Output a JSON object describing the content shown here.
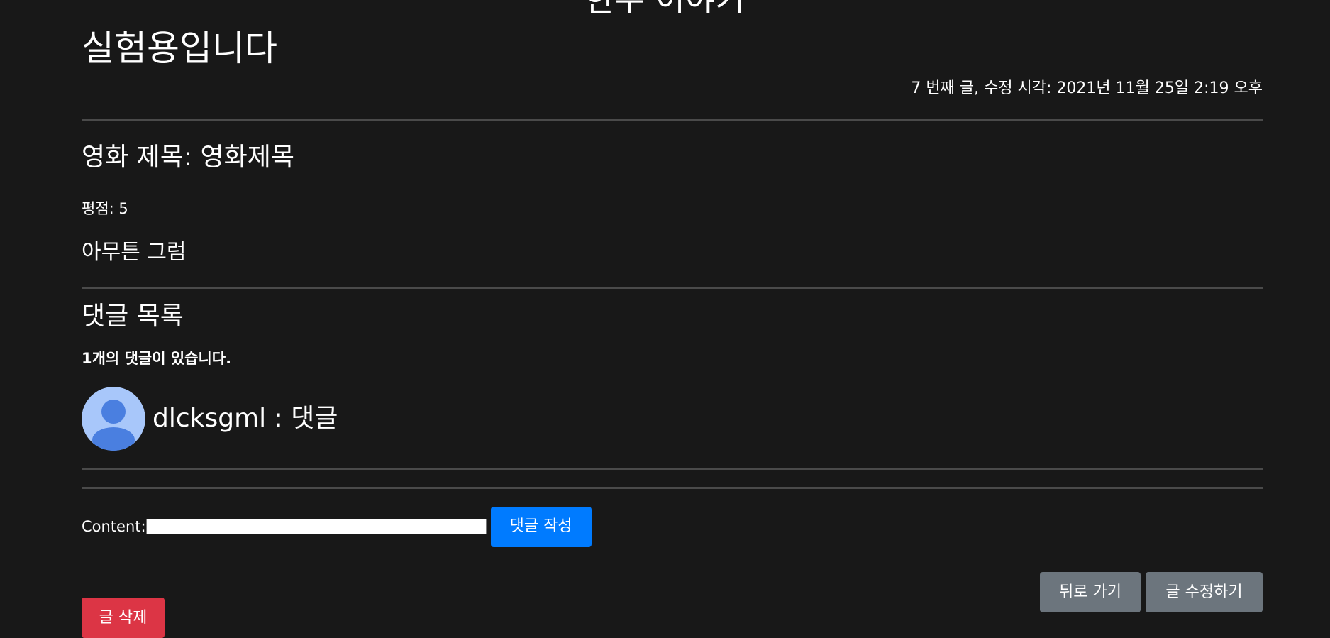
{
  "header": {
    "site_title": "한주 이야기"
  },
  "post": {
    "title": "실험용입니다",
    "meta": "7 번째 글, 수정 시각: 2021년 11월 25일 2:19 오후",
    "movie_title": "영화 제목: 영화제목",
    "rating": "평점: 5",
    "body": "아무튼 그럼"
  },
  "comments": {
    "heading": "댓글 목록",
    "count_text": "1개의 댓글이 있습니다.",
    "items": [
      {
        "text": "dlcksgml : 댓글",
        "avatar_icon": "user-avatar-icon"
      }
    ]
  },
  "comment_form": {
    "label": "Content:",
    "value": "",
    "submit_label": "댓글 작성"
  },
  "actions": {
    "back_label": "뒤로 가기",
    "edit_label": "글 수정하기",
    "delete_label": "글 삭제"
  },
  "colors": {
    "background": "#181818",
    "divider": "#4a4a4a",
    "primary": "#007bff",
    "secondary": "#6c757d",
    "danger": "#dc3545",
    "avatar_bg": "#a8c7fa",
    "avatar_fg": "#4a7fe0"
  }
}
